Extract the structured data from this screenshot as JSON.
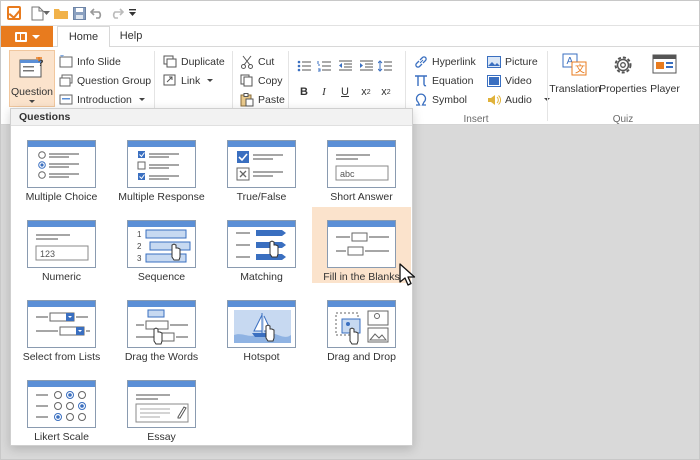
{
  "tabs": {
    "home": "Home",
    "help": "Help"
  },
  "ribbon": {
    "question": "Question",
    "info_slide": "Info Slide",
    "question_group": "Question Group",
    "introduction": "Introduction",
    "duplicate": "Duplicate",
    "link": "Link",
    "cut": "Cut",
    "copy": "Copy",
    "paste": "Paste",
    "bold": "B",
    "italic": "I",
    "underline": "U",
    "subscript": "x",
    "subscript_sub": "2",
    "superscript": "x",
    "superscript_sup": "2",
    "hyperlink": "Hyperlink",
    "equation": "Equation",
    "symbol": "Symbol",
    "picture": "Picture",
    "video": "Video",
    "audio": "Audio",
    "insert_label": "Insert",
    "translation": "Translation",
    "properties": "Properties",
    "player": "Player",
    "quiz_label": "Quiz"
  },
  "questions_panel": {
    "title": "Questions",
    "items": [
      {
        "label": "Multiple Choice"
      },
      {
        "label": "Multiple Response"
      },
      {
        "label": "True/False"
      },
      {
        "label": "Short Answer"
      },
      {
        "label": "Numeric"
      },
      {
        "label": "Sequence"
      },
      {
        "label": "Matching"
      },
      {
        "label": "Fill in the Blanks"
      },
      {
        "label": "Select from Lists"
      },
      {
        "label": "Drag the Words"
      },
      {
        "label": "Hotspot"
      },
      {
        "label": "Drag and Drop"
      },
      {
        "label": "Likert Scale"
      },
      {
        "label": "Essay"
      }
    ],
    "thumb_text": {
      "short_answer": "abc",
      "numeric": "123",
      "seq_1": "1",
      "seq_2": "2",
      "seq_3": "3"
    }
  },
  "colors": {
    "accent": "#e87b1e",
    "selected_bg": "#fbe3cc",
    "thumb_blue": "#5b8fd6"
  }
}
